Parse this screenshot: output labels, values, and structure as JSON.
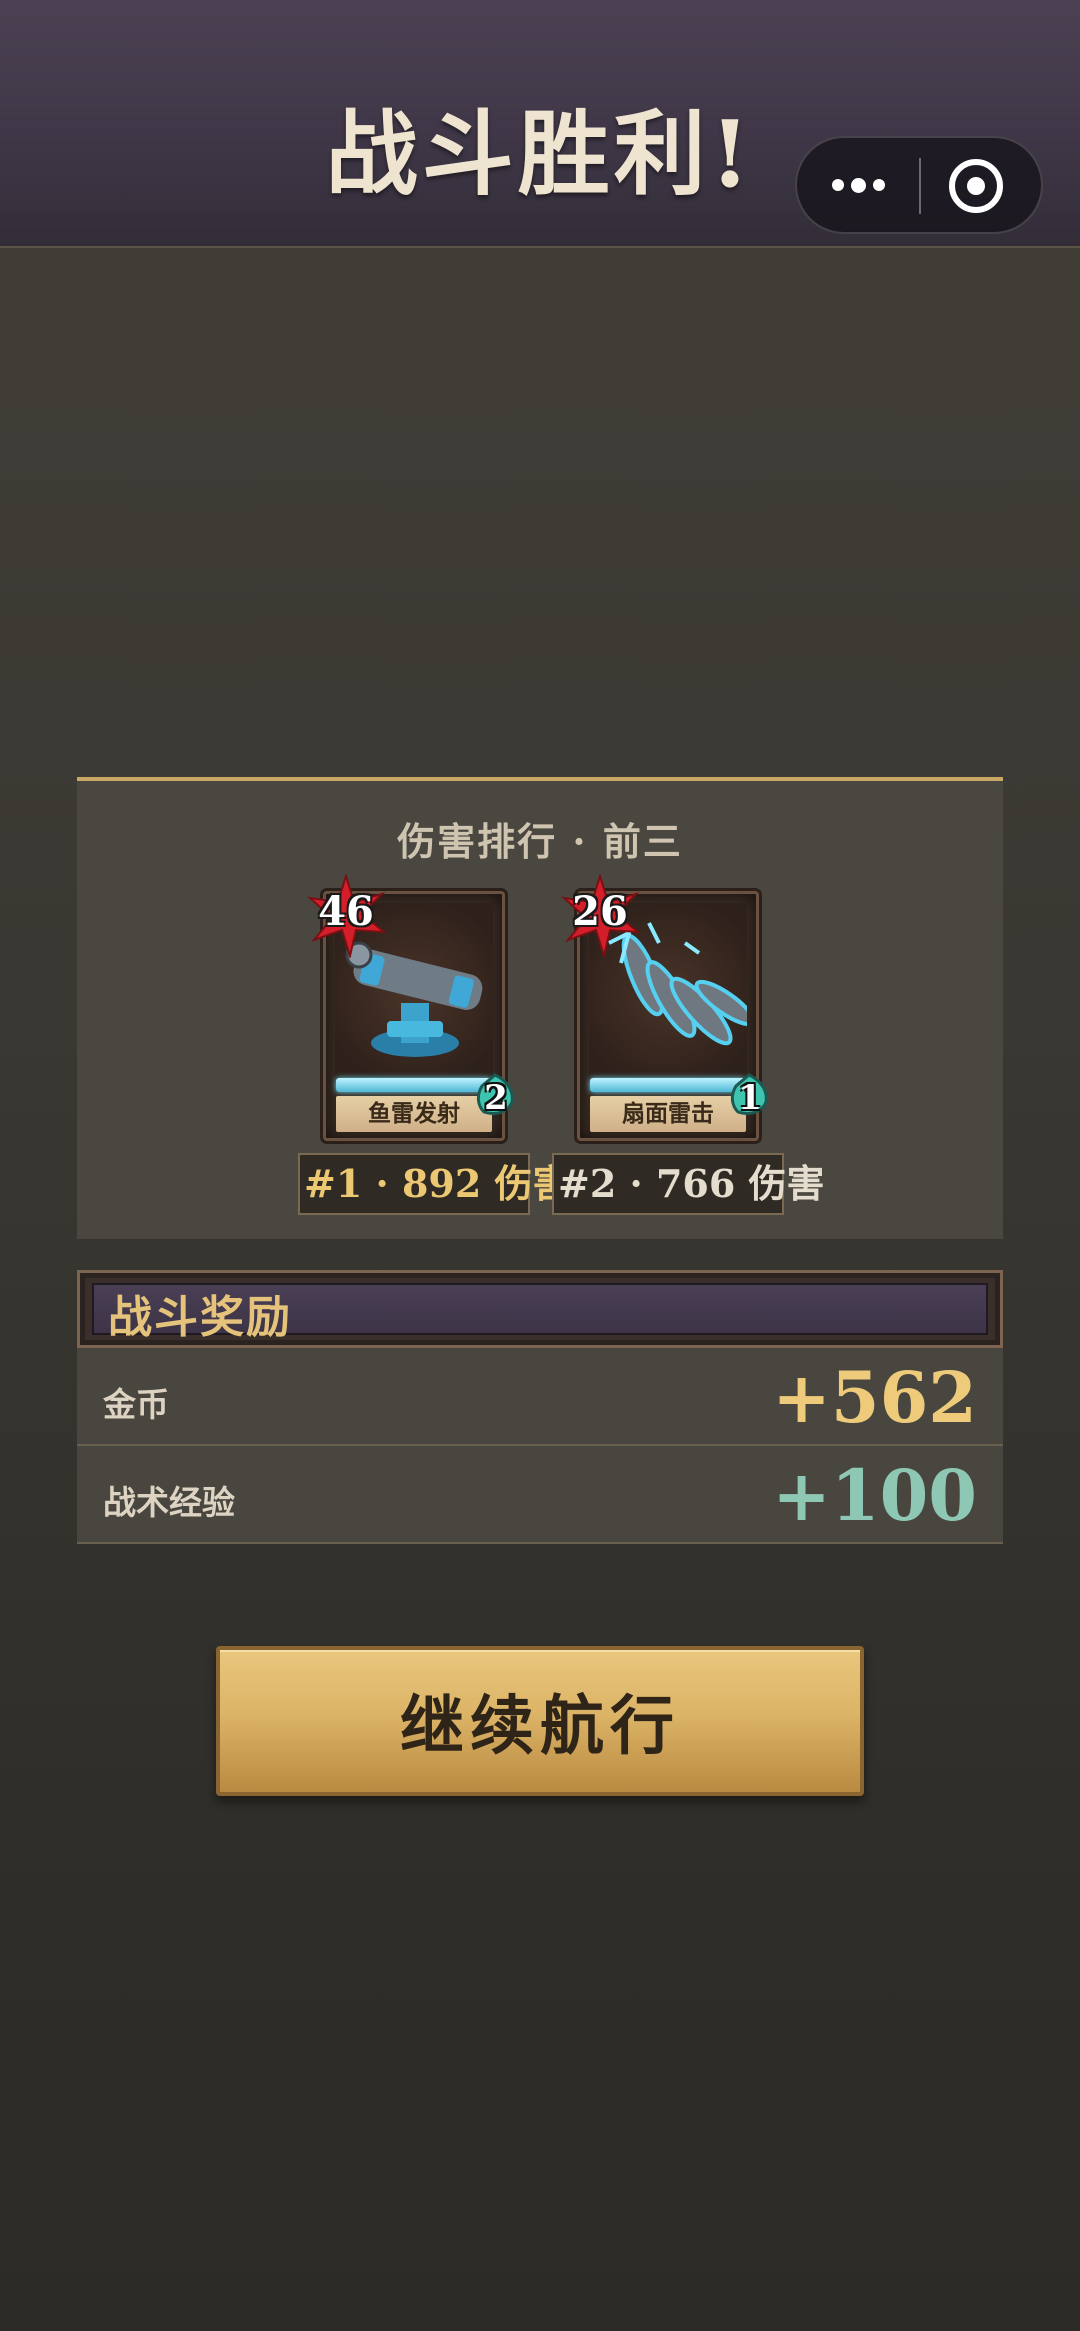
{
  "header": {
    "title": "战斗胜利!"
  },
  "ranking": {
    "title": "伤害排行 · 前三",
    "cards": [
      {
        "name": "鱼雷发射",
        "level": "46",
        "cost": "2",
        "damage_label": "#1 · 892 伤害",
        "art_icon": "torpedo-launcher-icon"
      },
      {
        "name": "扇面雷击",
        "level": "26",
        "cost": "1",
        "damage_label": "#2 · 766 伤害",
        "art_icon": "spread-torpedo-icon"
      }
    ]
  },
  "rewards": {
    "title": "战斗奖励",
    "items": [
      {
        "label": "金币",
        "value": "+562",
        "color": "#eecb7a"
      },
      {
        "label": "战术经验",
        "value": "+100",
        "color": "#8fc7b5"
      }
    ]
  },
  "continue_button": {
    "label": "继续航行"
  },
  "colors": {
    "accent_gold": "#c9a765",
    "button_gold": "#dcb467",
    "header_purple": "#4b4152"
  }
}
